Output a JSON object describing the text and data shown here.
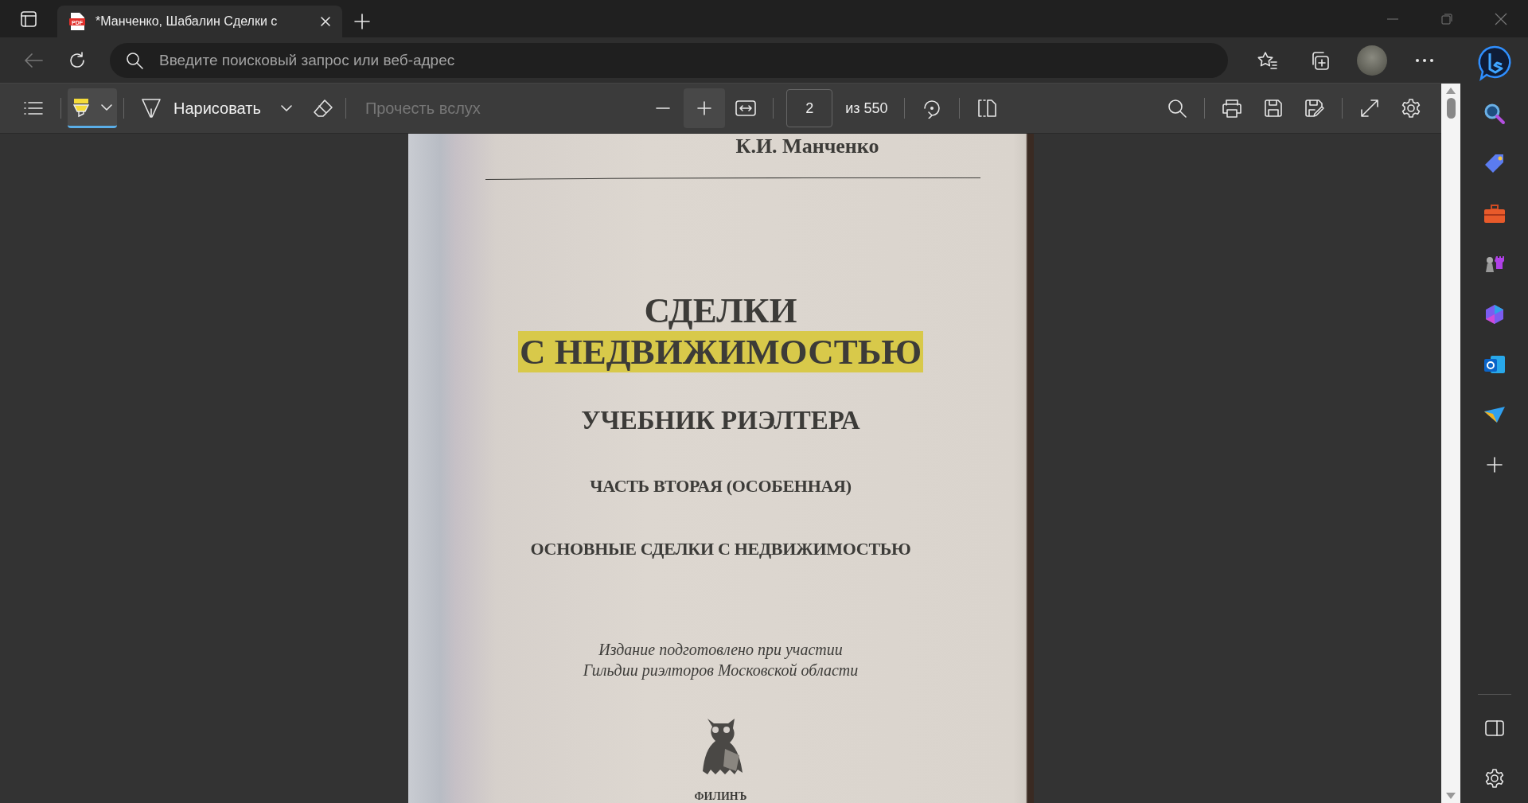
{
  "tab": {
    "icon_label": "PDF",
    "title": "*Манченко, Шабалин Сделки с",
    "selected": true
  },
  "address_bar": {
    "placeholder": "Введите поисковый запрос или веб-адрес"
  },
  "pdf_toolbar": {
    "highlight": {
      "selected": true
    },
    "draw": {
      "label": "Нарисовать"
    },
    "read_aloud": {
      "label": "Прочесть вслух",
      "disabled": true
    },
    "page_number": "2",
    "page_total": "из 550"
  },
  "page": {
    "author": "К.И. Манченко",
    "title_lines": [
      {
        "text": "СДЕЛКИ",
        "highlighted": false
      },
      {
        "text": "С НЕДВИЖИМОСТЬЮ",
        "highlighted": true
      }
    ],
    "subtitle": "УЧЕБНИК РИЭЛТЕРА",
    "part": "ЧАСТЬ ВТОРАЯ (ОСОБЕННАЯ)",
    "section": "ОСНОВНЫЕ СДЕЛКИ С НЕДВИЖИМОСТЬЮ",
    "note_lines": [
      "Издание подготовлено при участии",
      "Гильдии риэлторов Московской области"
    ],
    "publisher": "ФИЛИНЪ"
  }
}
